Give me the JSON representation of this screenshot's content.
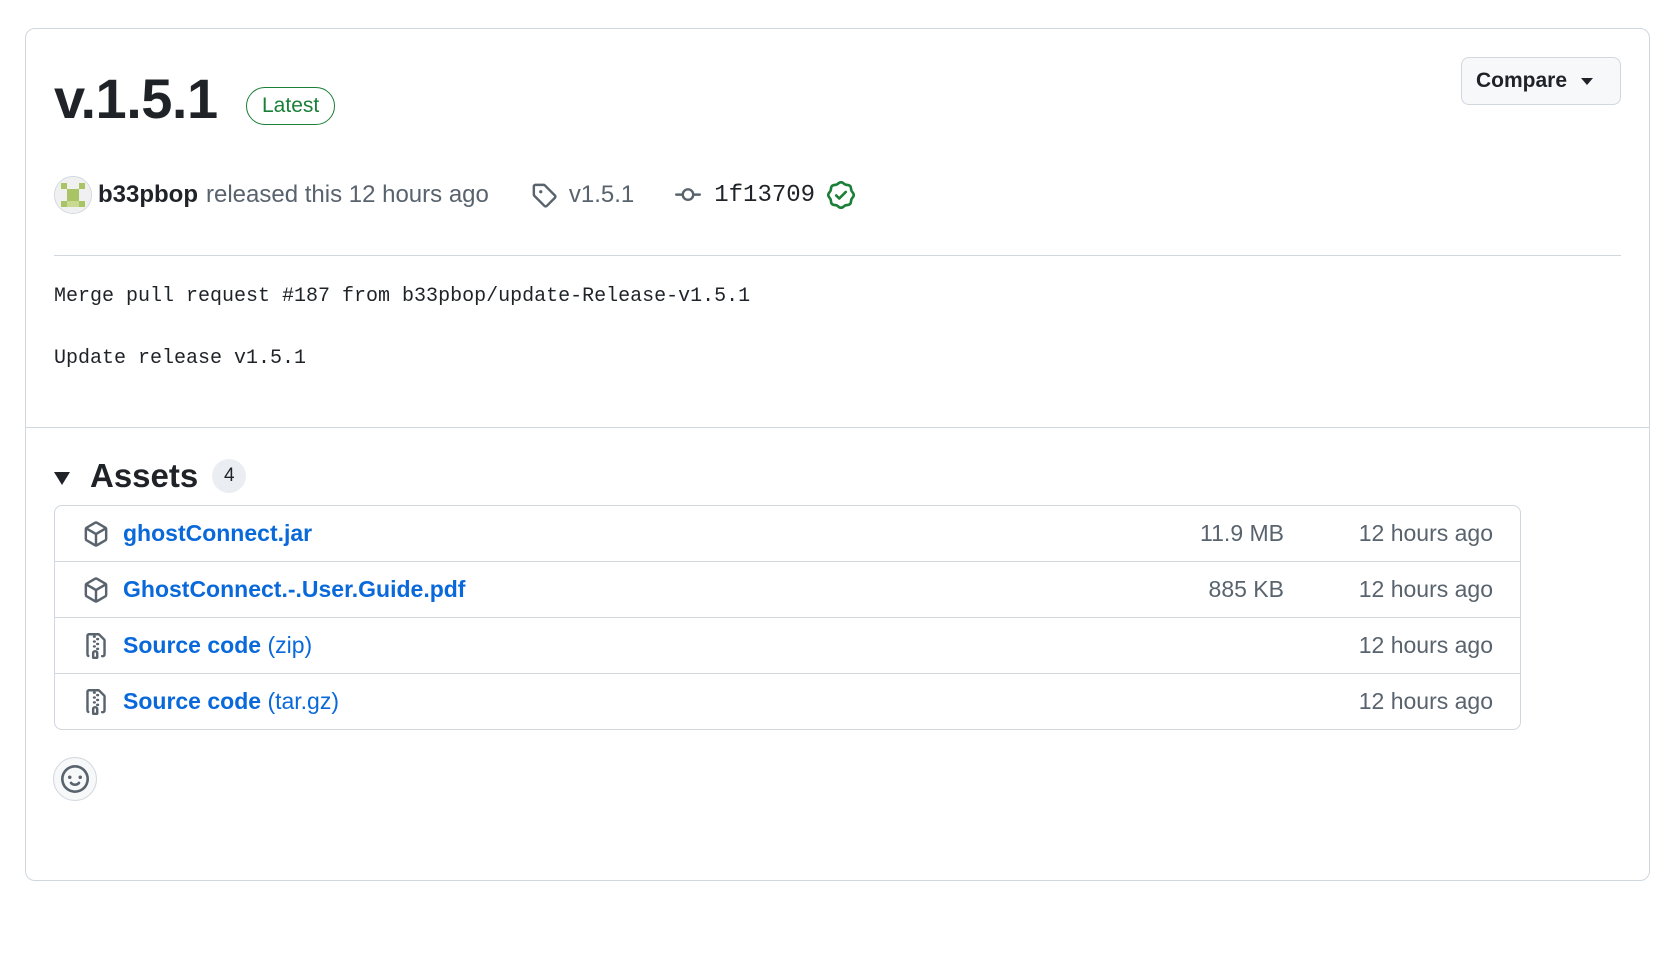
{
  "release": {
    "title": "v.1.5.1",
    "badge": "Latest",
    "compare_label": "Compare",
    "author": "b33pbop",
    "released_text": "released this 12 hours ago",
    "tag": "v1.5.1",
    "commit": "1f13709",
    "notes": [
      "Merge pull request #187 from b33pbop/update-Release-v1.5.1",
      "Update release v1.5.1"
    ]
  },
  "assets": {
    "title": "Assets",
    "count": "4",
    "items": [
      {
        "name": "ghostConnect.jar",
        "suffix": "",
        "size": "11.9 MB",
        "time": "12 hours ago",
        "icon": "package-icon"
      },
      {
        "name": "GhostConnect.-.User.Guide.pdf",
        "suffix": "",
        "size": "885 KB",
        "time": "12 hours ago",
        "icon": "package-icon"
      },
      {
        "name": "Source code",
        "suffix": "(zip)",
        "size": "",
        "time": "12 hours ago",
        "icon": "file-zip-icon"
      },
      {
        "name": "Source code",
        "suffix": "(tar.gz)",
        "size": "",
        "time": "12 hours ago",
        "icon": "file-zip-icon"
      }
    ]
  },
  "colors": {
    "accent": "#0969da",
    "success": "#1a7f37",
    "border": "#d0d7de",
    "muted": "#59636e"
  }
}
